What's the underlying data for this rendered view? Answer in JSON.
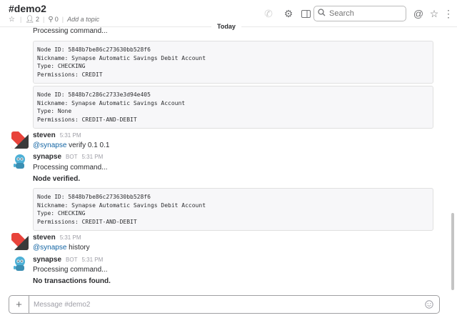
{
  "header": {
    "channel": "#demo2",
    "members": "2",
    "pins": "0",
    "topic": "Add a topic",
    "search_placeholder": "Search"
  },
  "divider": {
    "label": "Today"
  },
  "messages": [
    {
      "type": "continuation",
      "lines": [
        "Processing command..."
      ]
    },
    {
      "type": "code",
      "lines": [
        "Node ID: 5848b7be86c273630bb528f6",
        "Nickname: Synapse Automatic Savings Debit Account",
        "Type: CHECKING",
        "Permissions: CREDIT"
      ]
    },
    {
      "type": "code",
      "lines": [
        "Node ID: 5848b7c286c2733e3d94e405",
        "Nickname: Synapse Automatic Savings Account",
        "Type: None",
        "Permissions: CREDIT-AND-DEBIT"
      ]
    },
    {
      "type": "user",
      "author": "steven",
      "time": "5:31 PM",
      "mention": "@synapse",
      "text": " verify 0.1 0.1"
    },
    {
      "type": "bot",
      "author": "synapse",
      "tag": "BOT",
      "time": "5:31 PM",
      "line1": "Processing command...",
      "line2": "Node verified."
    },
    {
      "type": "code",
      "lines": [
        "Node ID: 5848b7be86c273630bb528f6",
        "Nickname: Synapse Automatic Savings Debit Account",
        "Type: CHECKING",
        "Permissions: CREDIT-AND-DEBIT"
      ]
    },
    {
      "type": "user",
      "author": "steven",
      "time": "5:31 PM",
      "mention": "@synapse",
      "text": " history"
    },
    {
      "type": "bot",
      "author": "synapse",
      "tag": "BOT",
      "time": "5:31 PM",
      "line1": "Processing command...",
      "line2": "No transactions found."
    }
  ],
  "composer": {
    "placeholder": "Message #demo2"
  },
  "colors": {
    "accent": "#1264a3",
    "avatar_red": "#e8433b",
    "bot_blue": "#4db0d6"
  }
}
